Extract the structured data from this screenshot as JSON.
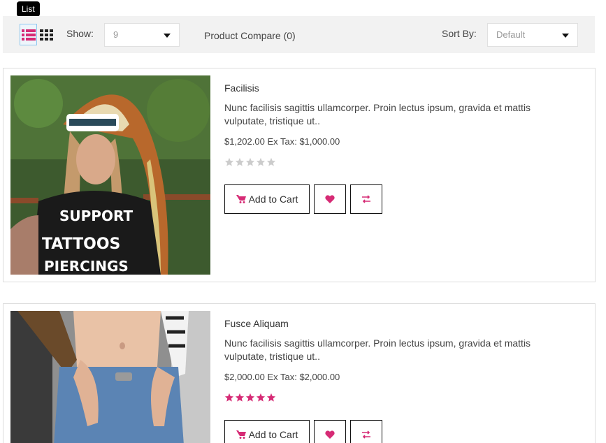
{
  "tooltip": {
    "text": "List"
  },
  "toolbar": {
    "show_label": "Show:",
    "show_value": "9",
    "compare_text": "Product Compare (0)",
    "sort_label": "Sort By:",
    "sort_value": "Default"
  },
  "colors": {
    "accent": "#d62b75",
    "star_off": "#cccccc",
    "list_icon": "#d62b75",
    "grid_icon": "#222222"
  },
  "products": [
    {
      "name": "Facilisis",
      "description": "Nunc facilisis sagittis ullamcorper. Proin lectus ipsum, gravida et mattis vulputate, tristique ut..",
      "price": "$1,202.00 Ex Tax: $1,000.00",
      "rating": 0,
      "add_to_cart": "Add to Cart",
      "image_icon": "product-photo"
    },
    {
      "name": "Fusce Aliquam",
      "description": "Nunc facilisis sagittis ullamcorper. Proin lectus ipsum, gravida et mattis vulputate, tristique ut..",
      "price": "$2,000.00 Ex Tax: $2,000.00",
      "rating": 5,
      "add_to_cart": "Add to Cart",
      "image_icon": "product-photo"
    }
  ]
}
